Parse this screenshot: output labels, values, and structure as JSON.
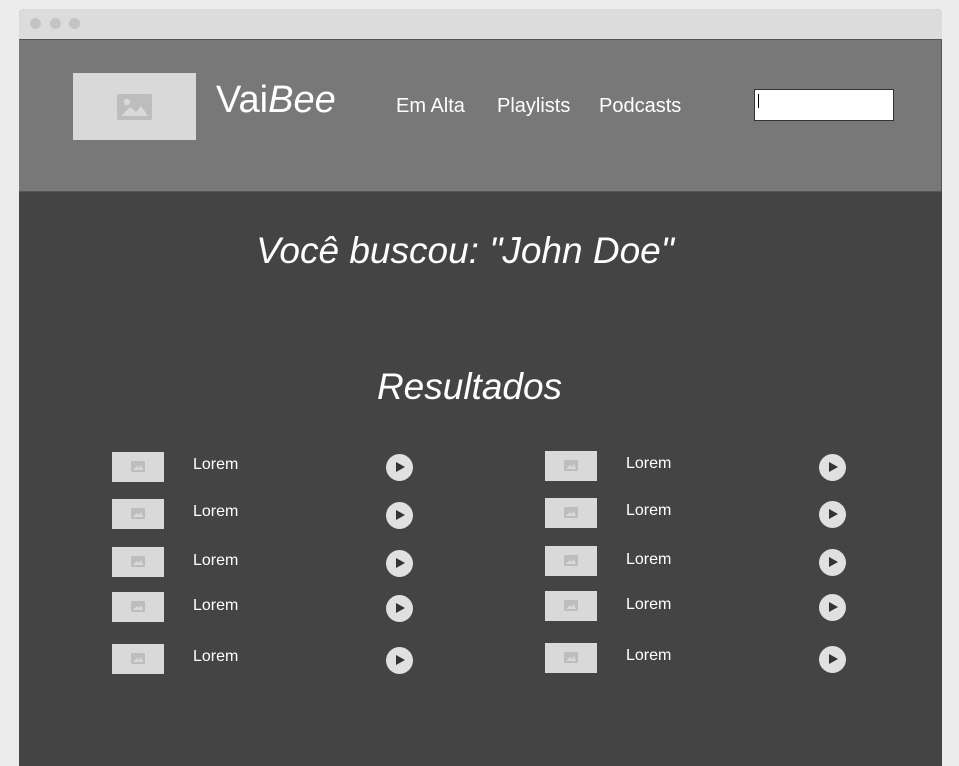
{
  "header": {
    "brand_prefix": "Vai",
    "brand_suffix": "Bee",
    "nav": [
      "Em Alta",
      "Playlists",
      "Podcasts"
    ],
    "search_value": ""
  },
  "main": {
    "query_title": "Você buscou: \"John Doe\"",
    "results_title": "Resultados"
  },
  "results": {
    "left": [
      "Lorem",
      "Lorem",
      "Lorem",
      "Lorem",
      "Lorem"
    ],
    "right": [
      "Lorem",
      "Lorem",
      "Lorem",
      "Lorem",
      "Lorem"
    ]
  },
  "icons": {
    "logo": "image-placeholder-icon",
    "thumbnail": "image-placeholder-icon",
    "play": "play-icon"
  }
}
